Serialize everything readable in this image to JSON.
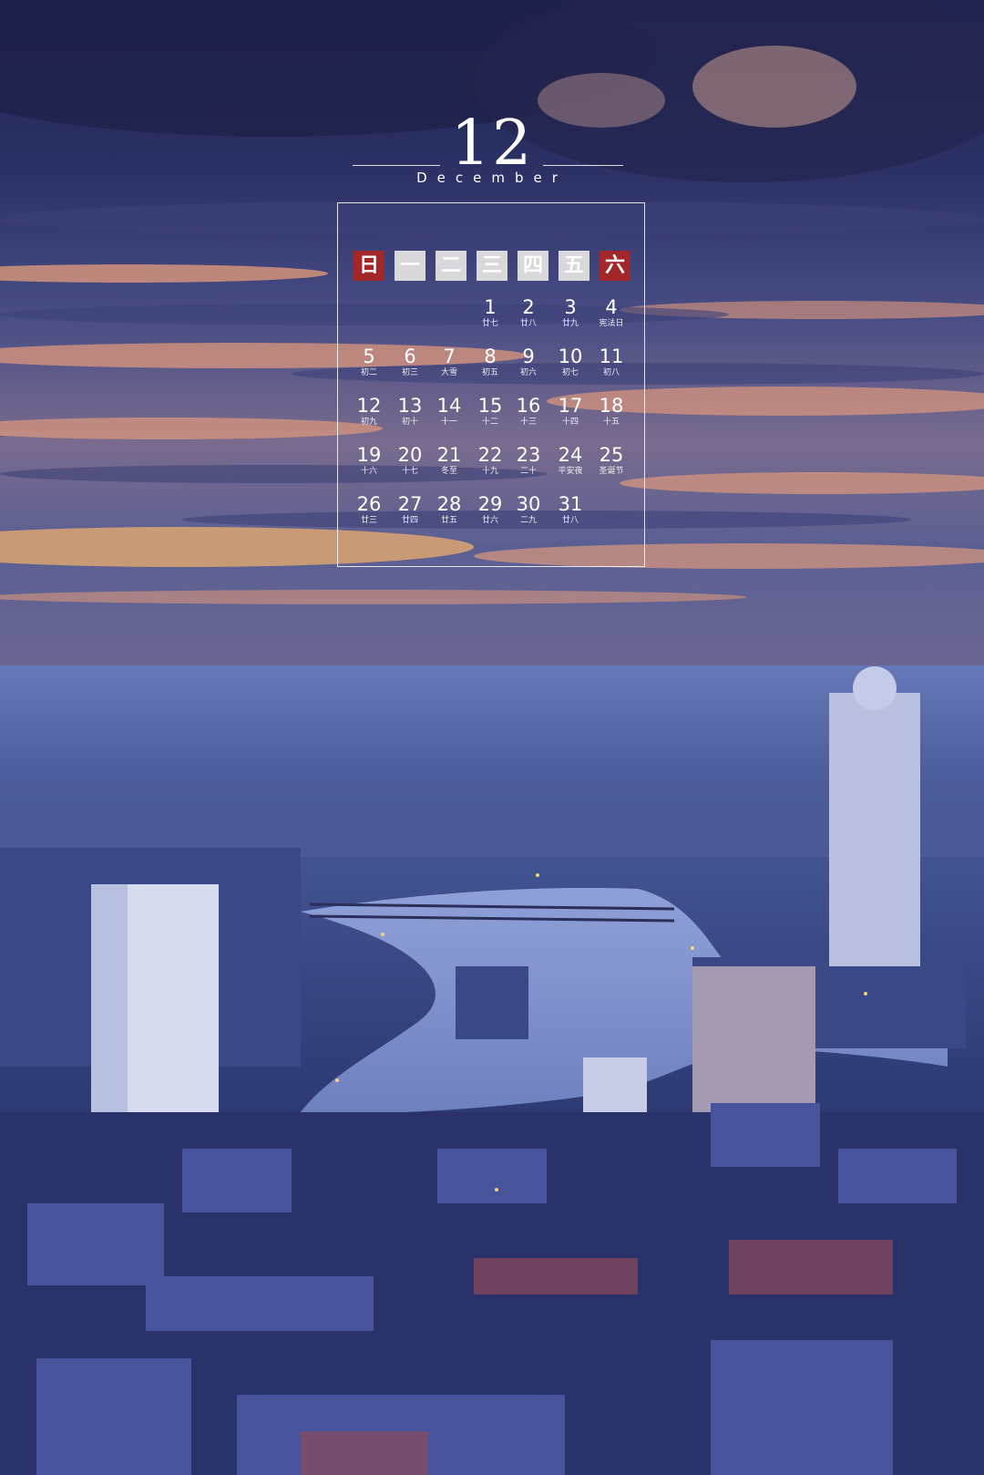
{
  "calendar": {
    "month_number": "12",
    "month_name": "December",
    "weekdays": [
      "日",
      "一",
      "二",
      "三",
      "四",
      "五",
      "六"
    ],
    "weeks": [
      [
        null,
        null,
        null,
        {
          "day": "1",
          "lunar": "廿七"
        },
        {
          "day": "2",
          "lunar": "廿八"
        },
        {
          "day": "3",
          "lunar": "廿九"
        },
        {
          "day": "4",
          "lunar": "宪法日"
        }
      ],
      [
        {
          "day": "5",
          "lunar": "初二"
        },
        {
          "day": "6",
          "lunar": "初三"
        },
        {
          "day": "7",
          "lunar": "大雪"
        },
        {
          "day": "8",
          "lunar": "初五"
        },
        {
          "day": "9",
          "lunar": "初六"
        },
        {
          "day": "10",
          "lunar": "初七"
        },
        {
          "day": "11",
          "lunar": "初八"
        }
      ],
      [
        {
          "day": "12",
          "lunar": "初九"
        },
        {
          "day": "13",
          "lunar": "初十"
        },
        {
          "day": "14",
          "lunar": "十一"
        },
        {
          "day": "15",
          "lunar": "十二"
        },
        {
          "day": "16",
          "lunar": "十三"
        },
        {
          "day": "17",
          "lunar": "十四"
        },
        {
          "day": "18",
          "lunar": "十五"
        }
      ],
      [
        {
          "day": "19",
          "lunar": "十六"
        },
        {
          "day": "20",
          "lunar": "十七"
        },
        {
          "day": "21",
          "lunar": "冬至"
        },
        {
          "day": "22",
          "lunar": "十九"
        },
        {
          "day": "23",
          "lunar": "二十"
        },
        {
          "day": "24",
          "lunar": "平安夜"
        },
        {
          "day": "25",
          "lunar": "圣诞节"
        }
      ],
      [
        {
          "day": "26",
          "lunar": "廿三"
        },
        {
          "day": "27",
          "lunar": "廿四"
        },
        {
          "day": "28",
          "lunar": "廿五"
        },
        {
          "day": "29",
          "lunar": "廿六"
        },
        {
          "day": "30",
          "lunar": "二九"
        },
        {
          "day": "31",
          "lunar": "廿八"
        }
      ]
    ]
  },
  "colors": {
    "weekend_header": "#a3262a",
    "weekday_header": "#d9d9dc",
    "text": "#ffffff"
  }
}
